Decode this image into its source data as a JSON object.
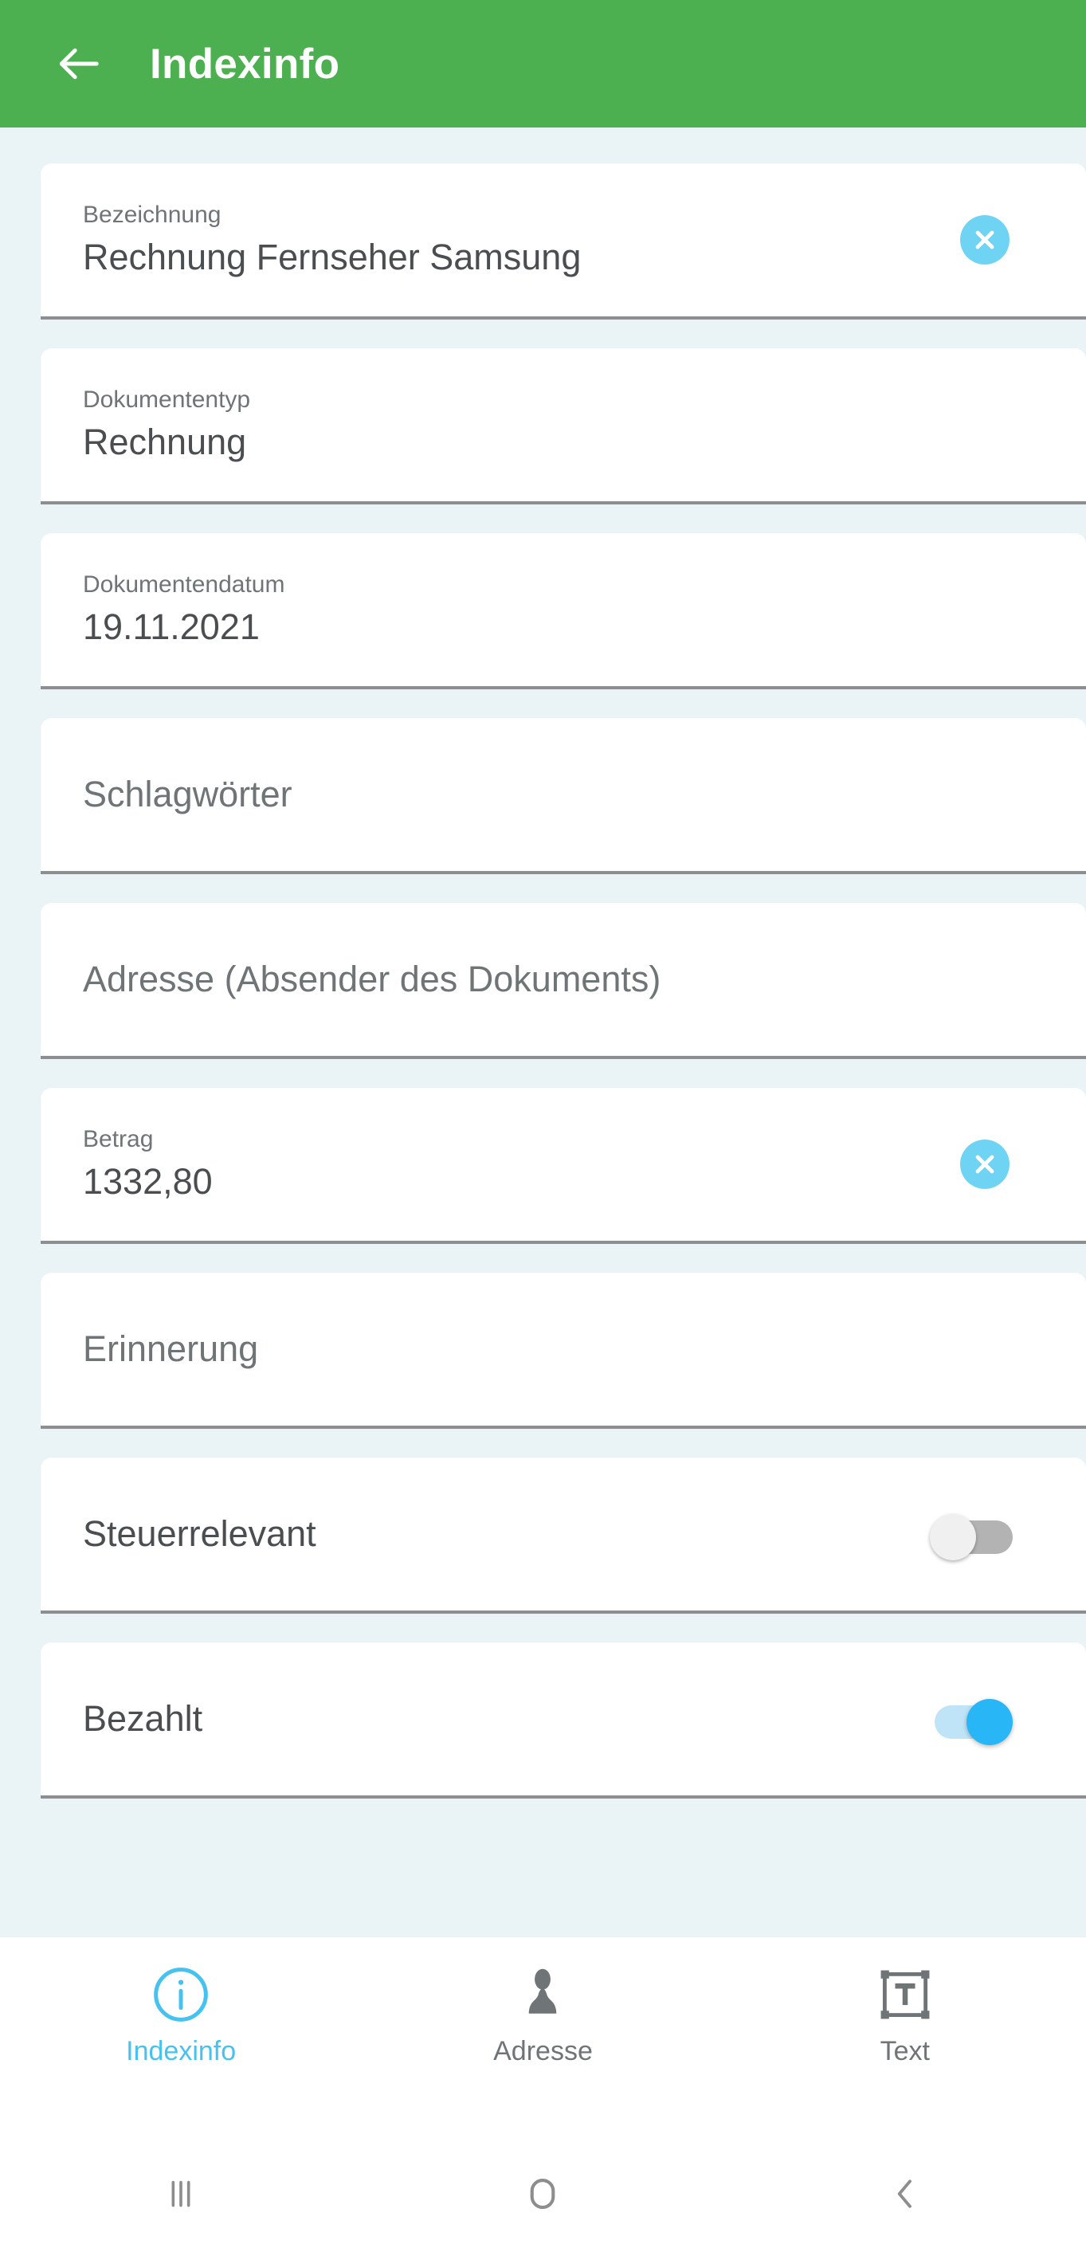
{
  "appbar": {
    "title": "Indexinfo",
    "back_icon": "arrow-left-icon",
    "background_color": "#4caf50"
  },
  "theme": {
    "page_background": "#eaf3f6",
    "card_background": "#ffffff",
    "underline_color": "#8b8f92",
    "accent_blue": "#45c2f0",
    "clear_button_color": "#6fd3f3",
    "switch_on_thumb": "#29b6f6",
    "switch_on_track": "#bfe4f8",
    "switch_off_track": "#b3b3b3",
    "switch_off_thumb": "#f0f0f0",
    "label_color": "#6f7477",
    "value_color": "#4a4e51"
  },
  "fields": [
    {
      "id": "bezeichnung",
      "type": "text",
      "label": "Bezeichnung",
      "value": "Rechnung Fernseher Samsung",
      "placeholder": "Bezeichnung",
      "has_clear": true,
      "clear_icon": "clear-circle-icon"
    },
    {
      "id": "dokumententyp",
      "type": "text",
      "label": "Dokumententyp",
      "value": "Rechnung",
      "placeholder": "Dokumententyp",
      "has_clear": false
    },
    {
      "id": "dokumentendatum",
      "type": "text",
      "label": "Dokumentendatum",
      "value": "19.11.2021",
      "placeholder": "Dokumentendatum",
      "has_clear": false
    },
    {
      "id": "schlagwoerter",
      "type": "text",
      "label": "",
      "value": "",
      "placeholder": "Schlagwörter",
      "has_clear": false
    },
    {
      "id": "adresse",
      "type": "text",
      "label": "",
      "value": "",
      "placeholder": "Adresse (Absender des Dokuments)",
      "has_clear": false
    },
    {
      "id": "betrag",
      "type": "text",
      "label": "Betrag",
      "value": "1332,80",
      "placeholder": "Betrag",
      "has_clear": true,
      "clear_icon": "clear-circle-icon"
    },
    {
      "id": "erinnerung",
      "type": "text",
      "label": "",
      "value": "",
      "placeholder": "Erinnerung",
      "has_clear": false
    },
    {
      "id": "steuerrelevant",
      "type": "switch",
      "label": "Steuerrelevant",
      "state": "off",
      "state_label": "Aus"
    },
    {
      "id": "bezahlt",
      "type": "switch",
      "label": "Bezahlt",
      "state": "on",
      "state_label": "Ein"
    }
  ],
  "tabbar": {
    "items": [
      {
        "id": "indexinfo",
        "label": "Indexinfo",
        "icon": "info-circle-icon",
        "active": true
      },
      {
        "id": "adresse",
        "label": "Adresse",
        "icon": "person-icon",
        "active": false
      },
      {
        "id": "text",
        "label": "Text",
        "icon": "text-box-icon",
        "active": false
      }
    ]
  },
  "system_nav": {
    "items": [
      {
        "id": "recents",
        "icon": "recents-icon",
        "label": "Letzte Apps"
      },
      {
        "id": "home",
        "icon": "home-icon",
        "label": "Startbildschirm"
      },
      {
        "id": "back",
        "icon": "back-chevron-icon",
        "label": "Zurück"
      }
    ]
  }
}
